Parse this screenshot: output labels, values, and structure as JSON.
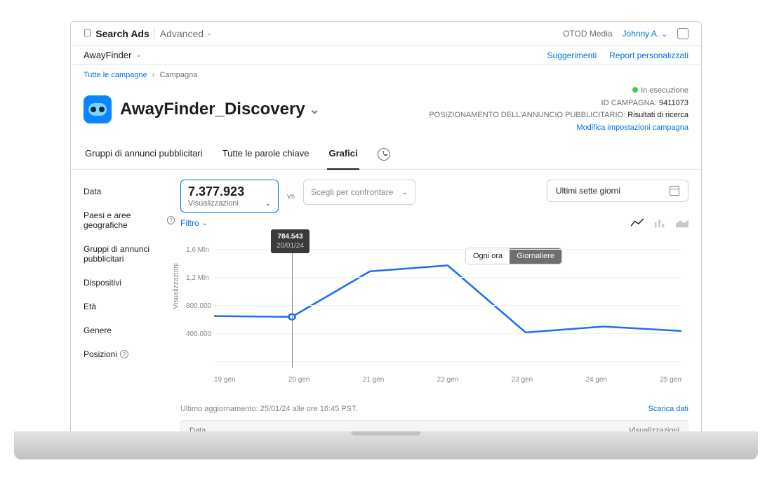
{
  "topbar": {
    "brand_main": "Search Ads",
    "brand_sub": "Advanced",
    "org": "OTOD Media",
    "user": "Johnny A."
  },
  "subbar": {
    "app": "AwayFinder",
    "link_suggest": "Suggerimenti",
    "link_reports": "Report personalizzati"
  },
  "crumbs": {
    "all": "Tutte le campagne",
    "current": "Campagna"
  },
  "title": {
    "name": "AwayFinder_Discovery",
    "status": "In esecuzione",
    "id_label": "ID CAMPAGNA:",
    "id_value": "9411073",
    "placement_label": "POSIZIONAMENTO DELL'ANNUNCIO PUBBLICITARIO:",
    "placement_value": "Risultati di ricerca",
    "edit_link": "Modifica impostazioni campagna"
  },
  "tabs": {
    "groups": "Gruppi di annunci pubblicitari",
    "keywords": "Tutte le parole chiave",
    "charts": "Grafici"
  },
  "sidebar": {
    "data": "Data",
    "geo": "Paesi e aree geografiche",
    "groups": "Gruppi di annunci pubblicitari",
    "devices": "Dispositivi",
    "age": "Età",
    "gender": "Genere",
    "positions": "Posizioni"
  },
  "metric": {
    "value": "7.377.923",
    "label": "Visualizzazioni",
    "compare": "Scegli per confrontare",
    "vs": "vs"
  },
  "datebox": {
    "label": "Ultimi sette giorni"
  },
  "filter": {
    "label": "Filtro"
  },
  "segment": {
    "hourly": "Ogni ora",
    "daily": "Giornaliere"
  },
  "chart_axis": {
    "ylabel": "Visualizzazioni",
    "y_16": "1,6 Mln",
    "y_12": "1,2 Mln",
    "y_08": "800.000",
    "y_04": "400.000"
  },
  "tooltip": {
    "value": "784.543",
    "date": "20/01/24"
  },
  "chart_data": {
    "type": "line",
    "ylabel": "Visualizzazioni",
    "ylim": [
      0,
      1600000
    ],
    "categories": [
      "19 gen",
      "20 gen",
      "21 gen",
      "22 gen",
      "23 gen",
      "24 gen",
      "25 gen"
    ],
    "values": [
      700000,
      690000,
      1300000,
      1380000,
      480000,
      560000,
      500000
    ],
    "highlight_index": 1,
    "highlight_value": 784543,
    "highlight_date": "20/01/24"
  },
  "under": {
    "updated": "Ultimo aggiornamento: 25/01/24 alle ore 16:45 PST.",
    "download": "Scarica dati"
  },
  "thead": {
    "col1": "Data",
    "col2": "Visualizzazioni"
  }
}
